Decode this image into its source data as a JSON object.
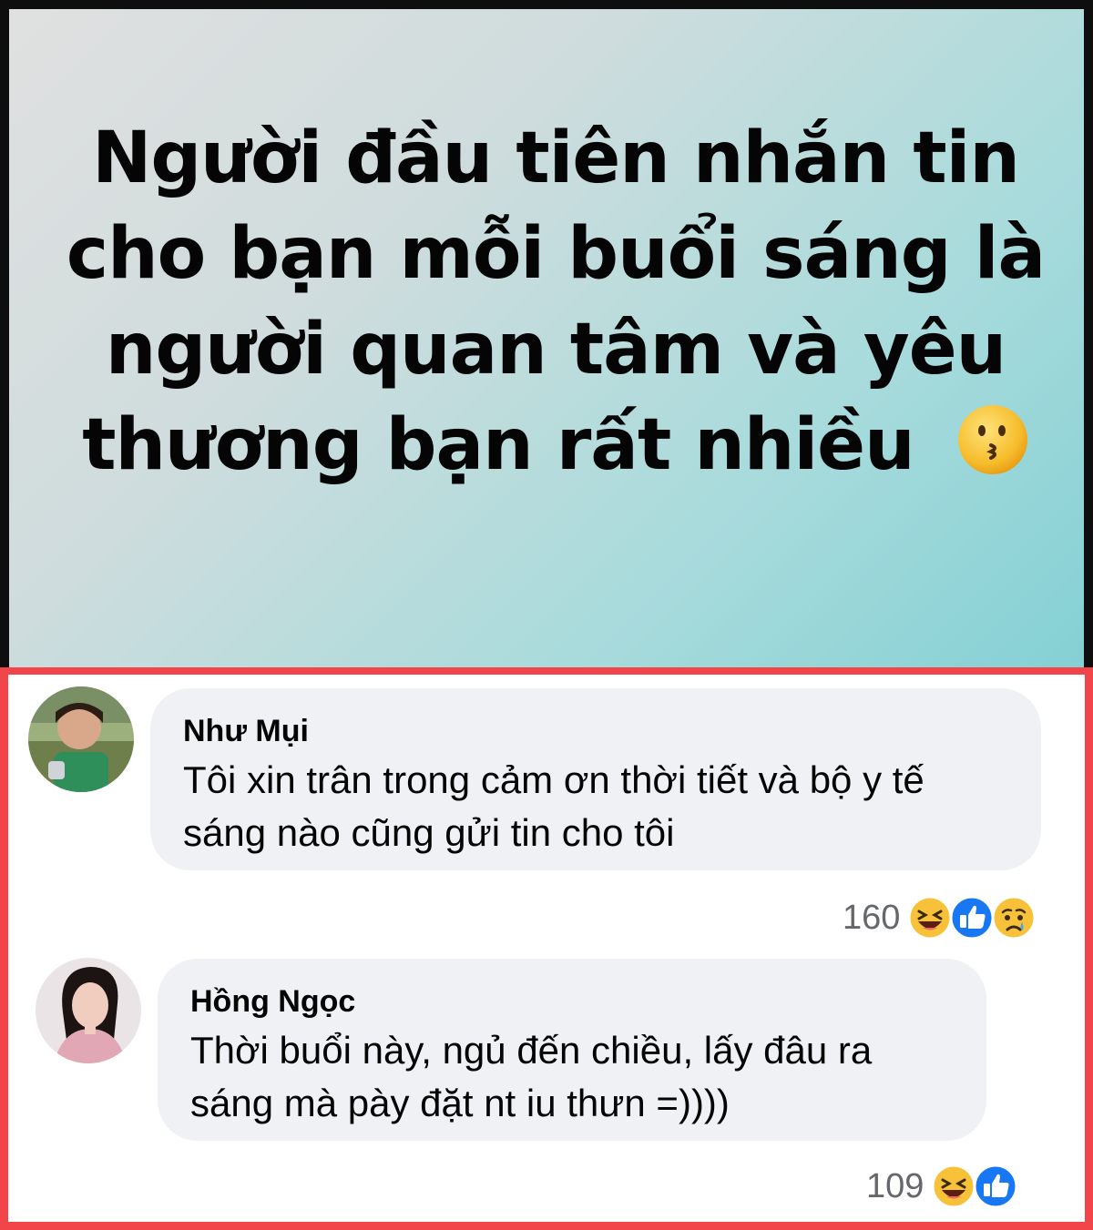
{
  "post": {
    "text": "Người đầu tiên nhắn tin cho bạn mỗi buổi sáng là người quan tâm và yêu thương bạn rất nhiều",
    "emoji": "kissing-face-icon"
  },
  "comments": [
    {
      "author": "Như Mụi",
      "text_line1": "Tôi xin trân trong cảm ơn thời tiết và bộ y tế",
      "text_line2": "sáng nào cũng gửi tin cho tôi",
      "reaction_count": "160",
      "reactions": [
        "haha-icon",
        "like-icon",
        "sad-icon"
      ]
    },
    {
      "author": "Hồng Ngọc",
      "text_line1": "Thời buổi này, ngủ đến chiều, lấy đâu ra",
      "text_line2": "sáng mà pày đặt nt iu thưn =))))",
      "reaction_count": "109",
      "reactions": [
        "haha-icon",
        "like-icon"
      ]
    }
  ],
  "colors": {
    "panel_border": "#f2454a",
    "bubble_bg": "#eff1f4",
    "like_blue": "#1877f2",
    "emoji_yellow": "#f7c23a"
  }
}
